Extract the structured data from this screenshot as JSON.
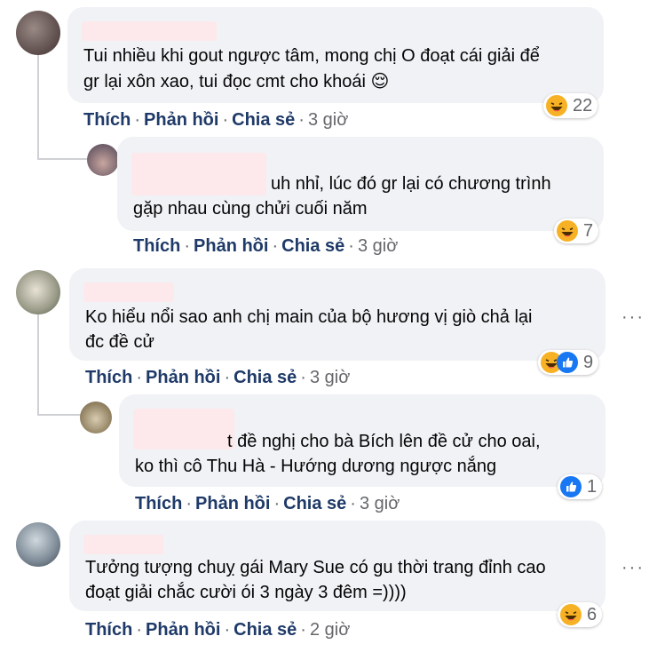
{
  "action_labels": {
    "like": "Thích",
    "reply": "Phản hồi",
    "share": "Chia sẻ",
    "sep": "·"
  },
  "comments": [
    {
      "line1": "Tui nhiều khi gout ngược tâm, mong chị O đoạt cái giải để",
      "line2": "gr lại xôn xao, tui đọc cmt cho khoái 😌",
      "time": "3 giờ",
      "reaction_count": "22",
      "reactions": [
        "haha-icon"
      ]
    },
    {
      "line1": "uh nhỉ, lúc đó gr lại có chương trình",
      "line2": "gặp nhau cùng chửi cuối năm",
      "time": "3 giờ",
      "reaction_count": "7",
      "reactions": [
        "haha-icon"
      ]
    },
    {
      "line1": "Ko hiểu nổi sao anh chị main của bộ hương vị giò chả lại",
      "line2": "đc đề cử",
      "time": "3 giờ",
      "reaction_count": "9",
      "reactions": [
        "haha-icon",
        "like-icon"
      ]
    },
    {
      "line1": "t đề nghị cho bà Bích lên đề cử cho oai,",
      "line2": "ko thì cô Thu Hà - Hướng dương ngược nắng",
      "time": "3 giờ",
      "reaction_count": "1",
      "reactions": [
        "like-icon"
      ]
    },
    {
      "line1": "Tưởng tượng chuỵ gái Mary Sue có gu thời trang đỉnh cao",
      "line2": "đoạt giải chắc cười ói 3 ngày 3 đêm =))))",
      "time": "2 giờ",
      "reaction_count": "6",
      "reactions": [
        "haha-icon"
      ]
    }
  ],
  "more_glyph": "···",
  "colors": {
    "bubble": "#f0f2f5",
    "action": "#1f3a68",
    "meta": "#65676b",
    "name_blur": "#fde9ec",
    "like_blue": "#1877f2",
    "haha_yellow": "#f7b125"
  }
}
